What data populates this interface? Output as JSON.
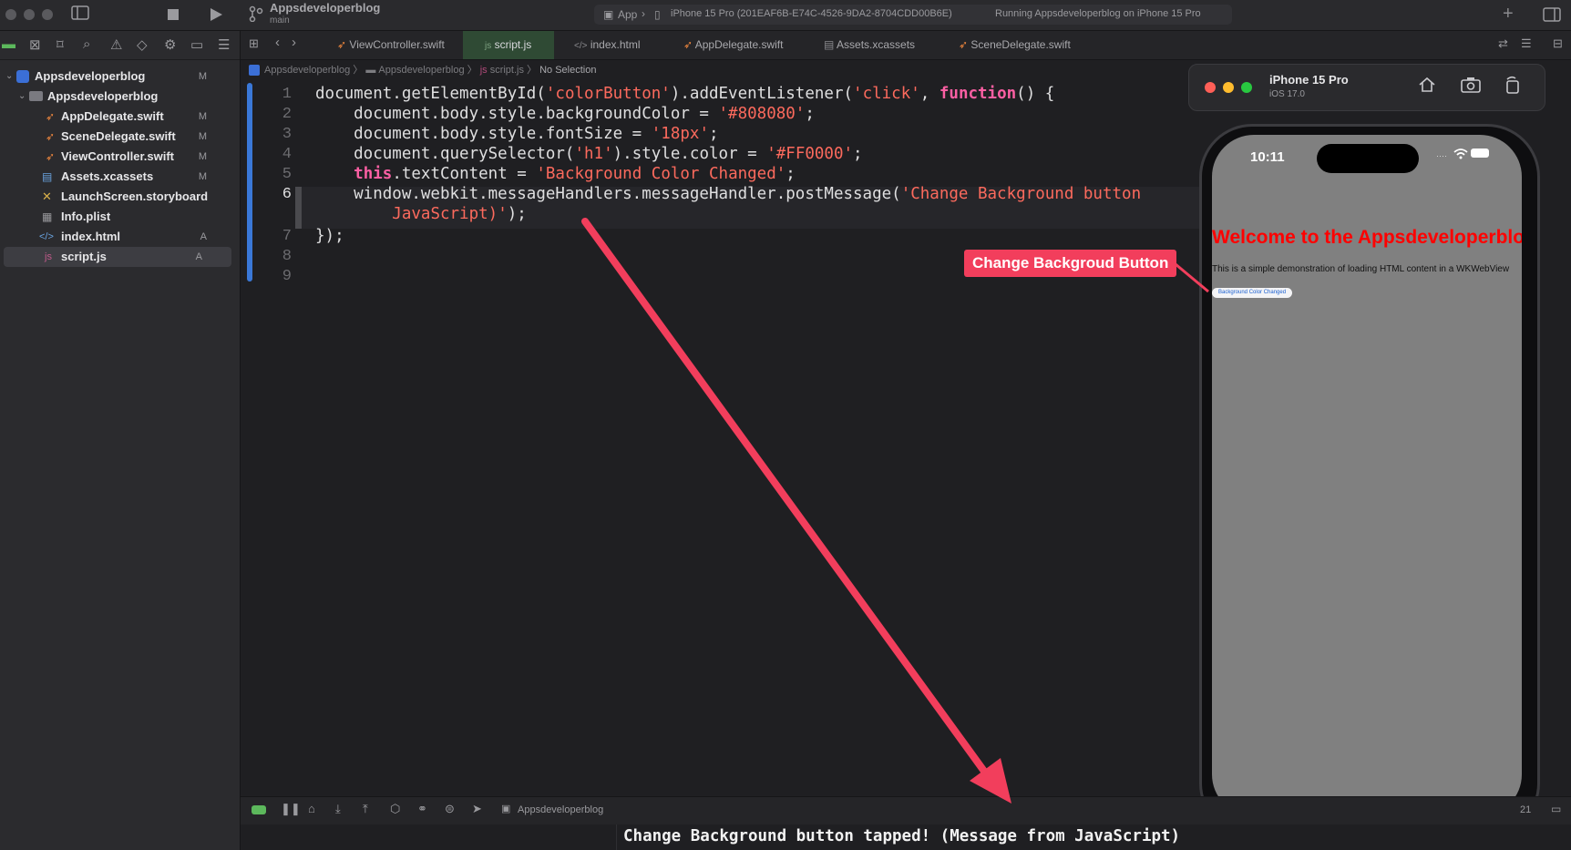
{
  "titlebar": {
    "project": "Appsdeveloperblog",
    "branch": "main",
    "scheme_app": "App",
    "destination": "iPhone 15 Pro (201EAF6B-E74C-4526-9DA2-8704CDD00B6E)",
    "status": "Running Appsdeveloperblog on iPhone 15 Pro"
  },
  "tabs": [
    {
      "label": "ViewController.swift",
      "icon": "swift-icon"
    },
    {
      "label": "script.js",
      "icon": "js-icon"
    },
    {
      "label": "index.html",
      "icon": "html-icon"
    },
    {
      "label": "AppDelegate.swift",
      "icon": "swift-icon"
    },
    {
      "label": "Assets.xcassets",
      "icon": "assets-icon"
    },
    {
      "label": "SceneDelegate.swift",
      "icon": "swift-icon"
    }
  ],
  "sidebar": {
    "items": [
      {
        "label": "Appsdeveloperblog",
        "badge": "M"
      },
      {
        "label": "Appsdeveloperblog",
        "badge": ""
      },
      {
        "label": "AppDelegate.swift",
        "badge": "M"
      },
      {
        "label": "SceneDelegate.swift",
        "badge": "M"
      },
      {
        "label": "ViewController.swift",
        "badge": "M"
      },
      {
        "label": "Assets.xcassets",
        "badge": "M"
      },
      {
        "label": "LaunchScreen.storyboard",
        "badge": ""
      },
      {
        "label": "Info.plist",
        "badge": ""
      },
      {
        "label": "index.html",
        "badge": "A"
      },
      {
        "label": "script.js",
        "badge": "A"
      }
    ]
  },
  "breadcrumb": {
    "b1": "Appsdeveloperblog",
    "b2": "Appsdeveloperblog",
    "b3": "script.js",
    "b4": "No Selection"
  },
  "code": {
    "line_numbers": [
      "1",
      "2",
      "3",
      "4",
      "5",
      "6",
      "7",
      "8",
      "9"
    ],
    "l1_a": "document.getElementById(",
    "l1_b": "'colorButton'",
    "l1_c": ").addEventListener(",
    "l1_d": "'click'",
    "l1_e": ", ",
    "l1_f": "function",
    "l1_g": "() {",
    "l2_a": "    document.body.style.backgroundColor = ",
    "l2_b": "'#808080'",
    "l2_c": ";",
    "l3_a": "    document.body.style.fontSize = ",
    "l3_b": "'18px'",
    "l3_c": ";",
    "l4_a": "    document.querySelector(",
    "l4_b": "'h1'",
    "l4_c": ").style.color = ",
    "l4_d": "'#FF0000'",
    "l4_e": ";",
    "l5_a": "    ",
    "l5_b": "this",
    "l5_c": ".textContent = ",
    "l5_d": "'Background Color Changed'",
    "l5_e": ";",
    "l6_a": "    window.webkit.messageHandlers.messageHandler.postMessage(",
    "l6_b": "'Change Background button",
    "l6w_a": "        ",
    "l6w_b": "JavaScript)'",
    "l6w_c": ");",
    "l7": "});"
  },
  "simulator": {
    "device": "iPhone 15 Pro",
    "os": "iOS 17.0",
    "time": "10:11",
    "heading": "Welcome to the Appsdeveloperblog",
    "paragraph": "This is a simple demonstration of loading HTML content in a WKWebView",
    "button": "Background Color Changed"
  },
  "annotation": "Change Backgroud Button",
  "debug": {
    "target": "Appsdeveloperblog",
    "line_suffix": "21"
  },
  "console": {
    "message": "Change Background button tapped! (Message from JavaScript)"
  },
  "colors": {
    "annotation": "#f23e5c",
    "heading": "#ff0000",
    "webview_bg": "#808080"
  }
}
